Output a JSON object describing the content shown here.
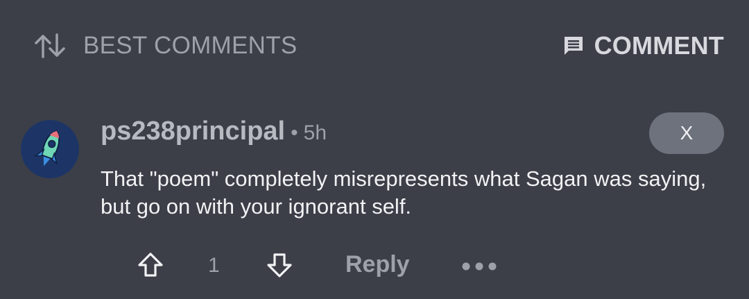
{
  "header": {
    "sort_label": "BEST COMMENTS",
    "sort_icon": "sort-arrows-icon",
    "comment_button_label": "COMMENT",
    "comment_icon": "comment-icon"
  },
  "comment": {
    "author": "ps238principal",
    "separator": "•",
    "time": "5h",
    "close_label": "X",
    "body": "That \"poem\" completely misrepresents what Sagan was saying, but go on with your ignorant self.",
    "score": "1",
    "reply_label": "Reply",
    "avatar_icon": "rocket-icon"
  },
  "colors": {
    "background": "#3c3f48",
    "muted_text": "#9ea1a9",
    "primary_text": "#f1f2f4",
    "avatar_bg": "#1d3566",
    "close_button_bg": "#6e727d"
  }
}
